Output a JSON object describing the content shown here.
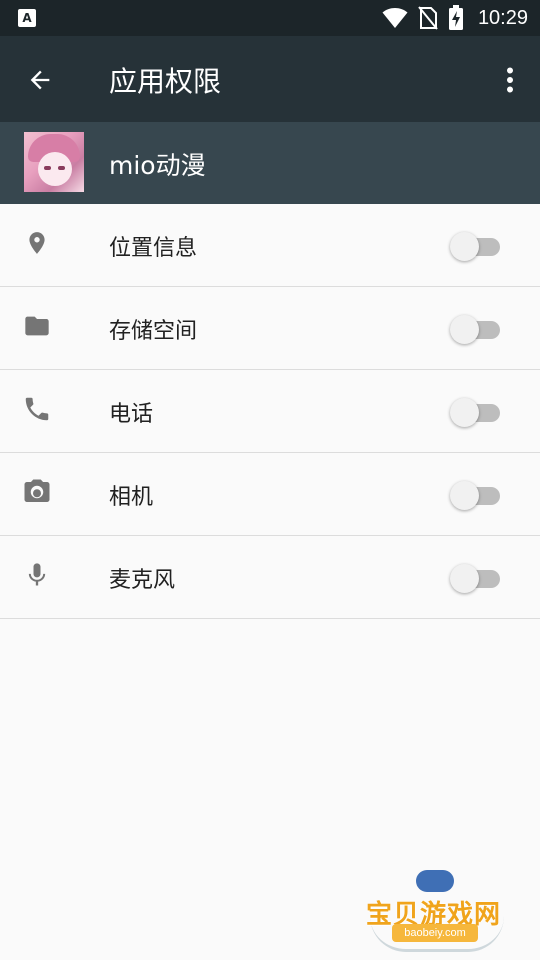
{
  "status_bar": {
    "left_badge": "A",
    "time": "10:29",
    "icons": [
      "wifi-icon",
      "no-sim-icon",
      "battery-charging-icon"
    ]
  },
  "app_bar": {
    "title": "应用权限",
    "back_icon": "arrow-back-icon",
    "more_icon": "more-vert-icon"
  },
  "app": {
    "name": "mio动漫"
  },
  "permissions": [
    {
      "icon": "location-icon",
      "label": "位置信息",
      "enabled": false
    },
    {
      "icon": "folder-icon",
      "label": "存储空间",
      "enabled": false
    },
    {
      "icon": "phone-icon",
      "label": "电话",
      "enabled": false
    },
    {
      "icon": "camera-icon",
      "label": "相机",
      "enabled": false
    },
    {
      "icon": "microphone-icon",
      "label": "麦克风",
      "enabled": false
    }
  ],
  "watermark": {
    "text": "宝贝游戏网",
    "url": "baobeiy.com"
  },
  "colors": {
    "status_bar_bg": "#1c2529",
    "app_bar_bg": "#263238",
    "app_header_bg": "#37474f",
    "list_bg": "#fafafa",
    "icon_gray": "#757575",
    "switch_off_track": "#bdbdbd",
    "switch_off_thumb": "#f1f1f1"
  }
}
